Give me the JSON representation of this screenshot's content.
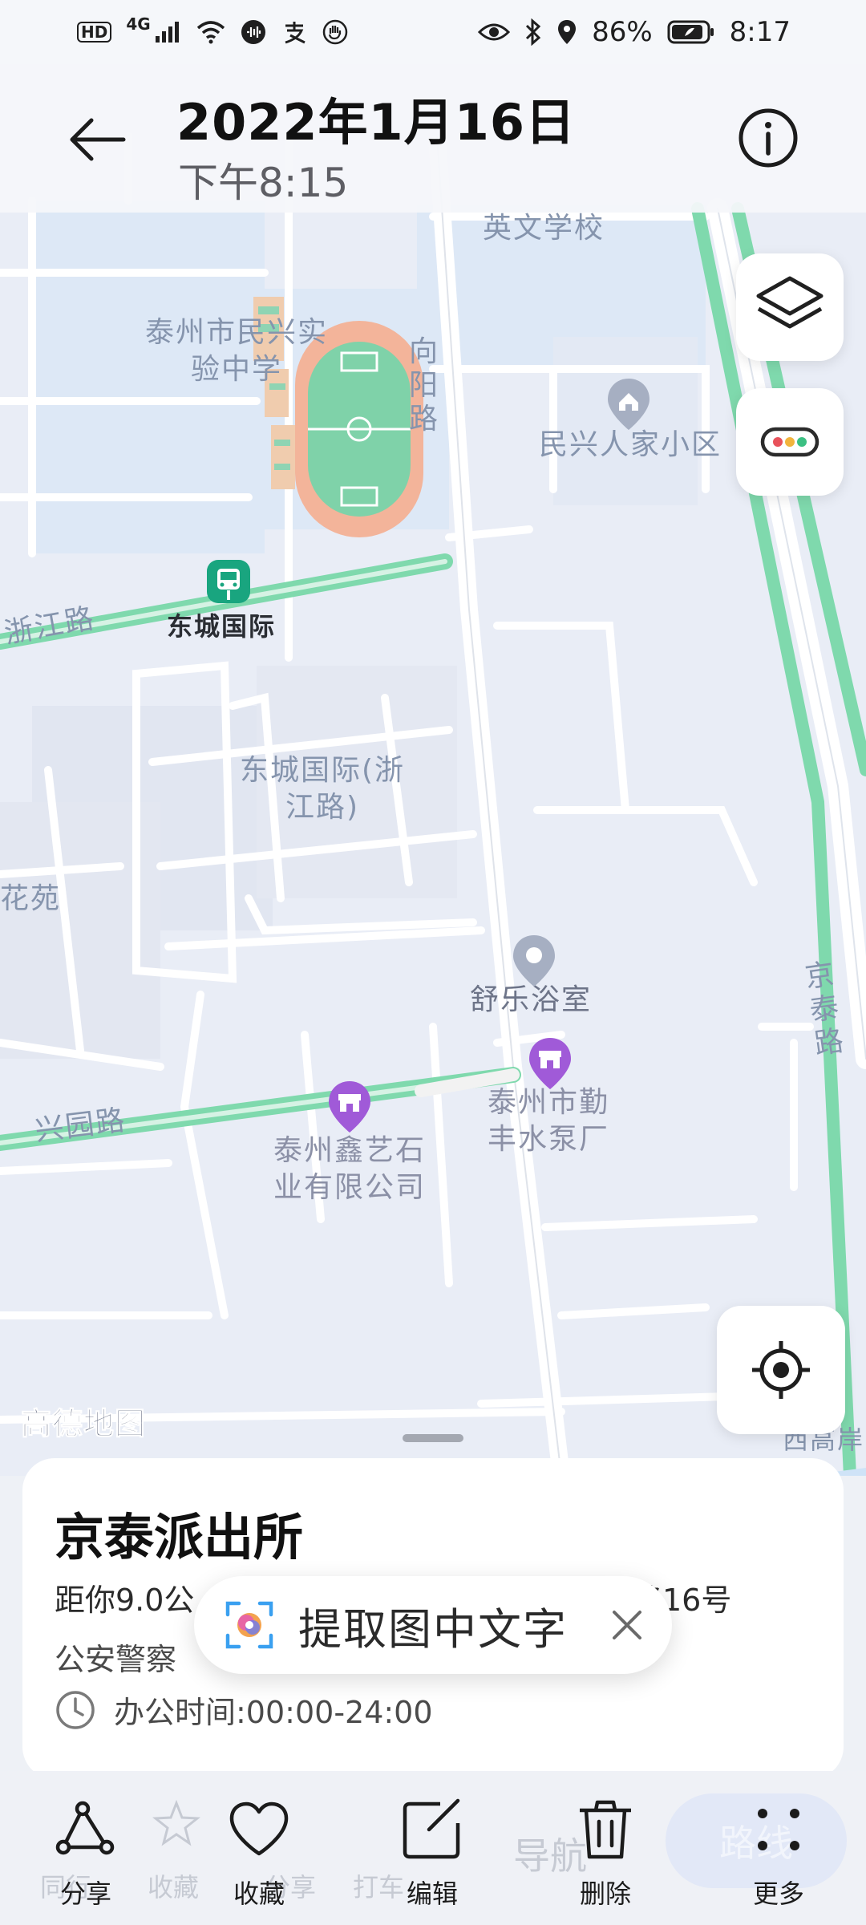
{
  "status_bar": {
    "left_badges": [
      "HD",
      "4G"
    ],
    "battery": "86%",
    "time": "8:17"
  },
  "header": {
    "title": "2022年1月16日",
    "subtitle": "下午8:15"
  },
  "map": {
    "labels": {
      "english_school": "英文学校",
      "school": "泰州市民兴实验中学",
      "xiangyang_road": "向阳路",
      "minxing_community": "民兴人家小区",
      "bus_stop": "东城国际",
      "zhejiang_road": "浙江路",
      "dongcheng_zhejiang": "东城国际(浙江路)",
      "garden": "花苑",
      "bathhouse": "舒乐浴室",
      "pump_factory": "泰州市勤丰水泵厂",
      "xingyuan_road": "兴园路",
      "stone_company": "泰州鑫艺石业有限公司",
      "jingtai_road": "京泰路",
      "west_gaogang": "西高岸"
    },
    "logo": "高德地图"
  },
  "place": {
    "name": "京泰派出所",
    "distance": "距你9.0公",
    "address_tail": "路16号",
    "category": "公安警察",
    "hours": "办公时间:00:00-24:00"
  },
  "ocr_popup": {
    "label": "提取图中文字"
  },
  "toolbar": {
    "background_labels": [
      "同行",
      "收藏",
      "分享",
      "打车",
      "导航"
    ],
    "route_label": "路线",
    "buttons": [
      {
        "label": "分享",
        "icon": "share-icon"
      },
      {
        "label": "收藏",
        "icon": "heart-icon"
      },
      {
        "label": "编辑",
        "icon": "edit-icon"
      },
      {
        "label": "删除",
        "icon": "trash-icon"
      },
      {
        "label": "更多",
        "icon": "more-icon"
      }
    ]
  },
  "colors": {
    "map_bg": "#e9edf6",
    "road": "#ffffff",
    "road_green": "#7fd9ad",
    "block_blue": "#dfe9f7",
    "poi_purple": "#a05ad8",
    "bus_green": "#19a57f"
  }
}
